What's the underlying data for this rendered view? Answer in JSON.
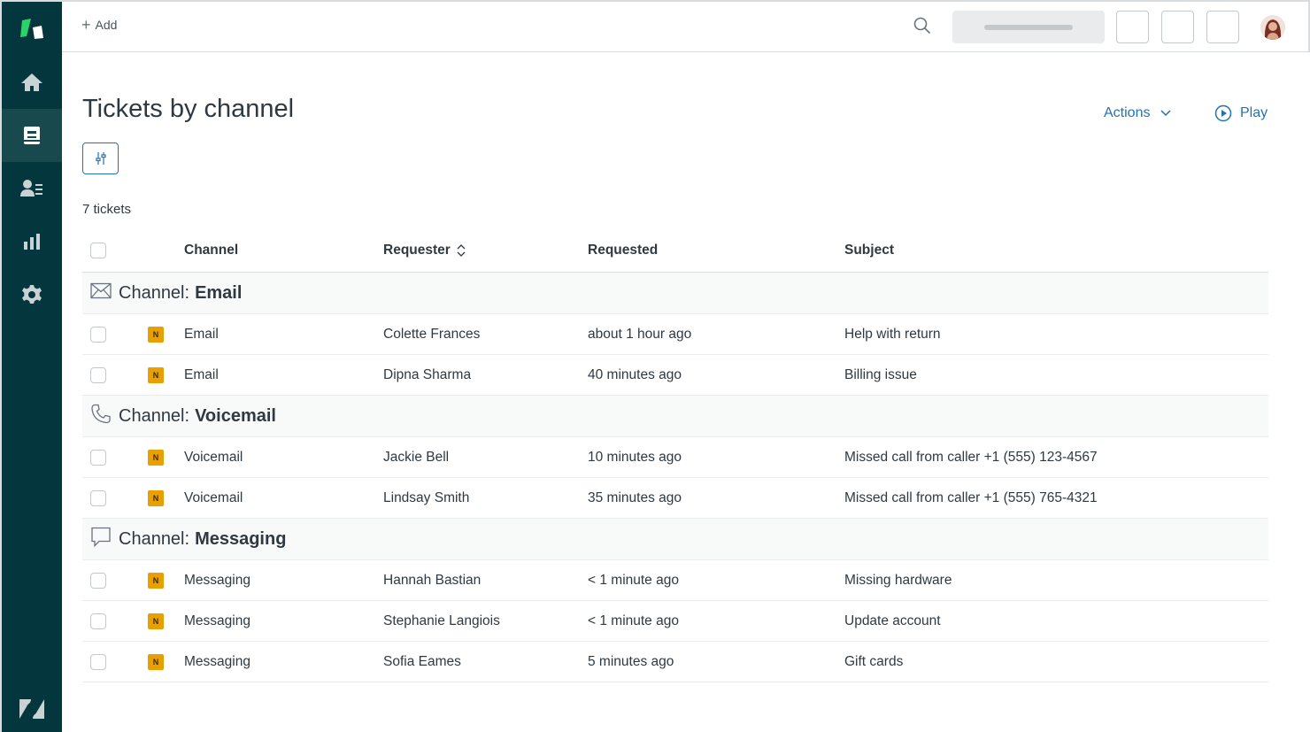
{
  "topbar": {
    "add_label": "Add"
  },
  "sidebar": {
    "items": [
      {
        "name": "home",
        "icon": "home-icon",
        "active": false
      },
      {
        "name": "tickets",
        "icon": "tickets-icon",
        "active": true
      },
      {
        "name": "customers",
        "icon": "customers-icon",
        "active": false
      },
      {
        "name": "reporting",
        "icon": "bar-chart-icon",
        "active": false
      },
      {
        "name": "admin",
        "icon": "gear-icon",
        "active": false
      }
    ]
  },
  "page": {
    "title": "Tickets by channel",
    "actions_label": "Actions",
    "play_label": "Play",
    "ticket_count": "7 tickets"
  },
  "table": {
    "columns": {
      "channel": "Channel",
      "requester": "Requester",
      "requested": "Requested",
      "subject": "Subject"
    },
    "groups": [
      {
        "prefix": "Channel:",
        "name": "Email",
        "icon": "envelope-icon",
        "rows": [
          {
            "status": "N",
            "channel": "Email",
            "requester": "Colette Frances",
            "requested": "about 1 hour ago",
            "subject": "Help with return"
          },
          {
            "status": "N",
            "channel": "Email",
            "requester": "Dipna Sharma",
            "requested": "40 minutes ago",
            "subject": "Billing issue"
          }
        ]
      },
      {
        "prefix": "Channel:",
        "name": "Voicemail",
        "icon": "phone-icon",
        "rows": [
          {
            "status": "N",
            "channel": "Voicemail",
            "requester": "Jackie Bell",
            "requested": "10 minutes ago",
            "subject": "Missed call from caller +1 (555) 123-4567"
          },
          {
            "status": "N",
            "channel": "Voicemail",
            "requester": "Lindsay Smith",
            "requested": "35 minutes ago",
            "subject": "Missed call from caller +1 (555) 765-4321"
          }
        ]
      },
      {
        "prefix": "Channel:",
        "name": "Messaging",
        "icon": "speech-bubble-icon",
        "rows": [
          {
            "status": "N",
            "channel": "Messaging",
            "requester": "Hannah Bastian",
            "requested": "< 1 minute ago",
            "subject": "Missing hardware"
          },
          {
            "status": "N",
            "channel": "Messaging",
            "requester": "Stephanie Langiois",
            "requested": "< 1 minute ago",
            "subject": "Update account"
          },
          {
            "status": "N",
            "channel": "Messaging",
            "requester": "Sofia Eames",
            "requested": "5 minutes ago",
            "subject": "Gift cards"
          }
        ]
      }
    ]
  },
  "colors": {
    "sidebar_bg": "#03363d",
    "accent_blue": "#1f73b7",
    "status_new": "#e8a000"
  }
}
